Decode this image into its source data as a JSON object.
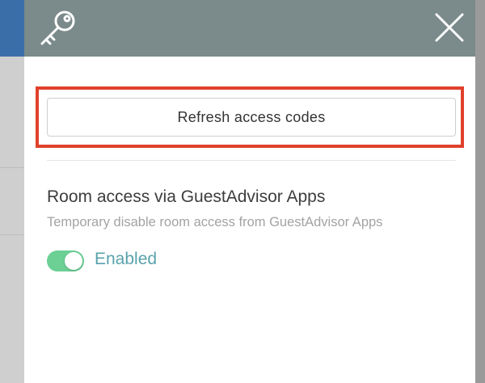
{
  "header": {
    "icon": "key-icon",
    "close_icon": "close-icon"
  },
  "actions": {
    "refresh_label": "Refresh access codes"
  },
  "room_access": {
    "title": "Room access via GuestAdvisor Apps",
    "description": "Temporary disable room access from GuestAdvisor Apps",
    "toggle_state": "on",
    "toggle_label": "Enabled"
  },
  "colors": {
    "header_bg": "#7b8a8b",
    "highlight": "#e0412c",
    "toggle_on": "#6ccf94",
    "toggle_label": "#5aa2ad"
  }
}
